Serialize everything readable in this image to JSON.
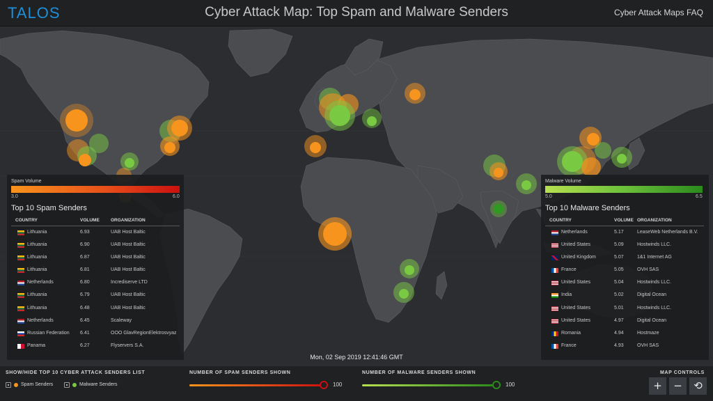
{
  "header": {
    "logo": "TALOS",
    "title": "Cyber Attack Map: Top Spam and Malware Senders",
    "faq_link": "Cyber Attack Maps FAQ"
  },
  "colors": {
    "spam": "#f7941d",
    "malware": "#7ac943",
    "background": "#2b2d30",
    "land": "#4a4c50"
  },
  "spam_panel": {
    "legend_label": "Spam Volume",
    "legend_min": "3.0",
    "legend_max": "6.0",
    "title": "Top 10 Spam Senders",
    "headers": {
      "country": "COUNTRY",
      "volume": "VOLUME",
      "organization": "ORGANIZATION"
    },
    "rows": [
      {
        "flag": "lithuania-flag",
        "country": "Lithuania",
        "volume": "6.93",
        "organization": "UAB Host Baltic"
      },
      {
        "flag": "lithuania-flag",
        "country": "Lithuania",
        "volume": "6.90",
        "organization": "UAB Host Baltic"
      },
      {
        "flag": "lithuania-flag",
        "country": "Lithuania",
        "volume": "6.87",
        "organization": "UAB Host Baltic"
      },
      {
        "flag": "lithuania-flag",
        "country": "Lithuania",
        "volume": "6.81",
        "organization": "UAB Host Baltic"
      },
      {
        "flag": "netherlands-flag",
        "country": "Netherlands",
        "volume": "6.80",
        "organization": "Incrediserve LTD"
      },
      {
        "flag": "lithuania-flag",
        "country": "Lithuania",
        "volume": "6.79",
        "organization": "UAB Host Baltic"
      },
      {
        "flag": "lithuania-flag",
        "country": "Lithuania",
        "volume": "6.48",
        "organization": "UAB Host Baltic"
      },
      {
        "flag": "netherlands-flag",
        "country": "Netherlands",
        "volume": "6.45",
        "organization": "Scaleway"
      },
      {
        "flag": "russia-flag",
        "country": "Russian Federation",
        "volume": "6.41",
        "organization": "OOO GlavRegionElektrosvyaz"
      },
      {
        "flag": "panama-flag",
        "country": "Panama",
        "volume": "6.27",
        "organization": "Flyservers S.A."
      }
    ]
  },
  "malware_panel": {
    "legend_label": "Malware Volume",
    "legend_min": "5.0",
    "legend_max": "6.5",
    "title": "Top 10 Malware Senders",
    "headers": {
      "country": "COUNTRY",
      "volume": "VOLUME",
      "organization": "ORGANIZATION"
    },
    "rows": [
      {
        "flag": "netherlands-flag",
        "country": "Netherlands",
        "volume": "5.17",
        "organization": "LeaseWeb Netherlands B.V."
      },
      {
        "flag": "usa-flag",
        "country": "United States",
        "volume": "5.09",
        "organization": "Hostwinds LLC."
      },
      {
        "flag": "uk-flag",
        "country": "United Kingdom",
        "volume": "5.07",
        "organization": "1&1 Internet AG"
      },
      {
        "flag": "france-flag",
        "country": "France",
        "volume": "5.05",
        "organization": "OVH SAS"
      },
      {
        "flag": "usa-flag",
        "country": "United States",
        "volume": "5.04",
        "organization": "Hostwinds LLC."
      },
      {
        "flag": "india-flag",
        "country": "India",
        "volume": "5.02",
        "organization": "Digital Ocean"
      },
      {
        "flag": "usa-flag",
        "country": "United States",
        "volume": "5.01",
        "organization": "Hostwinds LLC."
      },
      {
        "flag": "usa-flag",
        "country": "United States",
        "volume": "4.97",
        "organization": "Digital Ocean"
      },
      {
        "flag": "romania-flag",
        "country": "Romania",
        "volume": "4.94",
        "organization": "Hostmaze"
      },
      {
        "flag": "france-flag",
        "country": "France",
        "volume": "4.93",
        "organization": "OVH SAS"
      }
    ]
  },
  "timestamp": "Mon, 02 Sep 2019 12:41:46 GMT",
  "footer": {
    "toggle_label": "SHOW/HIDE TOP 10 CYBER ATTACK SENDERS LIST",
    "spam_toggle": "Spam Senders",
    "malware_toggle": "Malware Senders",
    "spam_shown_label": "NUMBER OF SPAM SENDERS SHOWN",
    "spam_shown_value": "100",
    "malware_shown_label": "NUMBER OF MALWARE SENDERS SHOWN",
    "malware_shown_value": "100",
    "map_controls_label": "MAP CONTROLS",
    "zoom_in": "+",
    "zoom_out": "−",
    "reset": "⟲"
  }
}
